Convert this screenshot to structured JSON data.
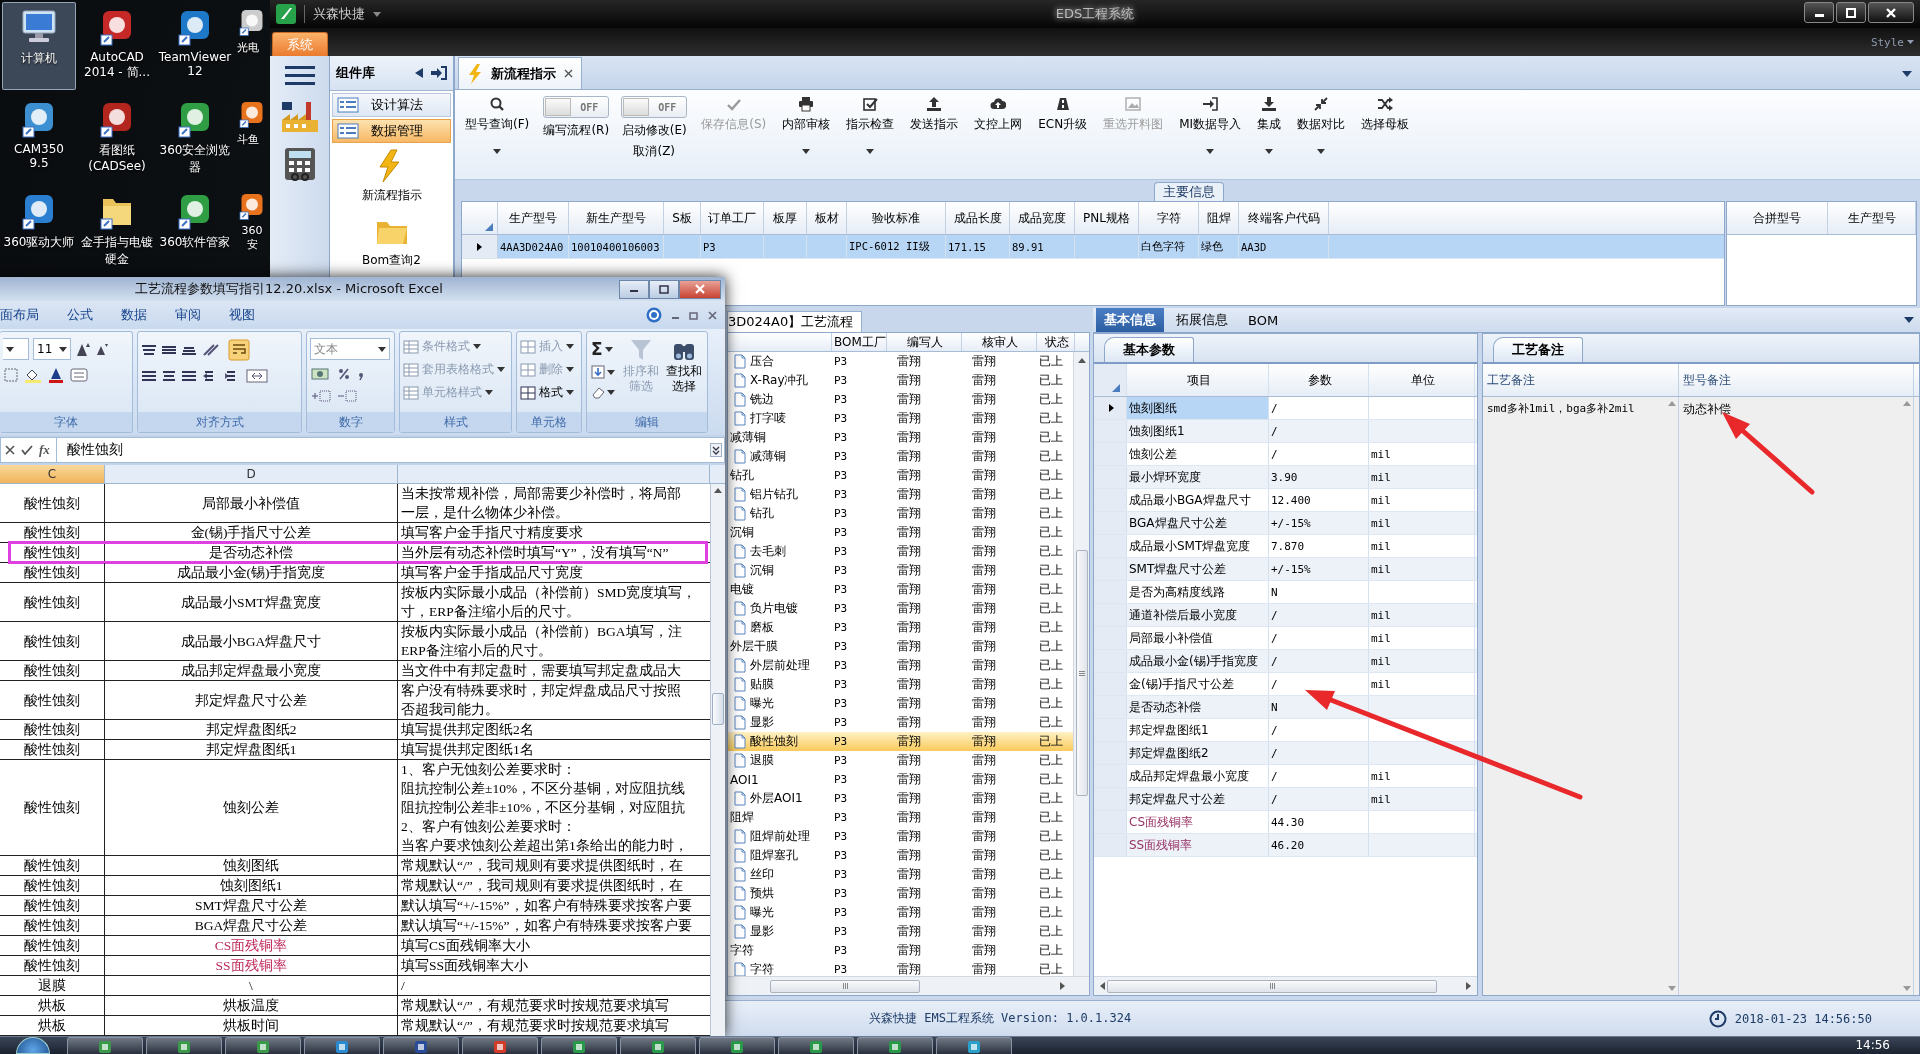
{
  "desktop": {
    "icons": [
      {
        "label": "计算机",
        "selected": true
      },
      {
        "label": "AutoCAD\n2014 - 简...",
        "selected": false
      },
      {
        "label": "TeamViewer\n12",
        "selected": false
      },
      {
        "label": "光电",
        "selected": false
      },
      {
        "label": "CAM350 9.5",
        "selected": false
      },
      {
        "label": "看图纸\n(CADSee)",
        "selected": false
      },
      {
        "label": "360安全浏览器",
        "selected": false
      },
      {
        "label": "斗鱼",
        "selected": false
      },
      {
        "label": "360驱动大师",
        "selected": false
      },
      {
        "label": "金手指与电镀硬金",
        "selected": false
      },
      {
        "label": "360软件管家",
        "selected": false
      },
      {
        "label": "360安",
        "selected": false
      }
    ]
  },
  "eds": {
    "app_name": "兴森快捷",
    "title": "EDS工程系统",
    "style_label": "Style",
    "system_tab": "系统",
    "library": {
      "title": "组件库",
      "categories": [
        {
          "label": "设计算法",
          "selected": false
        },
        {
          "label": "数据管理",
          "selected": true
        }
      ],
      "tools": [
        {
          "label": "新流程指示"
        },
        {
          "label": "Bom查询2"
        }
      ]
    },
    "doc_tab": "新流程指示",
    "toolbar": [
      {
        "kind": "button",
        "label": "型号查询(F)",
        "dropdown": true,
        "disabled": false
      },
      {
        "kind": "toggle",
        "label": "编写流程(R)",
        "switch_text": "OFF",
        "on": false
      },
      {
        "kind": "toggle",
        "label": "启动修改(E)",
        "sublabel": "取消(Z)",
        "switch_text": "OFF",
        "on": false
      },
      {
        "kind": "button",
        "label": "保存信息(S)",
        "dropdown": false,
        "disabled": true
      },
      {
        "kind": "button",
        "label": "内部审核",
        "dropdown": true,
        "disabled": false
      },
      {
        "kind": "button",
        "label": "指示检查",
        "dropdown": true,
        "disabled": false
      },
      {
        "kind": "button",
        "label": "发送指示",
        "dropdown": false,
        "disabled": false
      },
      {
        "kind": "button",
        "label": "文控上网",
        "dropdown": false,
        "disabled": false
      },
      {
        "kind": "button",
        "label": "ECN升级",
        "dropdown": false,
        "disabled": false
      },
      {
        "kind": "button",
        "label": "重选开料图",
        "dropdown": false,
        "disabled": true
      },
      {
        "kind": "button",
        "label": "MI数据导入",
        "dropdown": true,
        "disabled": false
      },
      {
        "kind": "button",
        "label": "集成",
        "dropdown": true,
        "disabled": false
      },
      {
        "kind": "button",
        "label": "数据对比",
        "dropdown": true,
        "disabled": false
      },
      {
        "kind": "button",
        "label": "选择母板",
        "dropdown": false,
        "disabled": false
      }
    ],
    "main_info": {
      "title": "主要信息",
      "columns": [
        "生产型号",
        "新生产型号",
        "S板",
        "订单工厂",
        "板厚",
        "板材",
        "验收标准",
        "成品长度",
        "成品宽度",
        "PNL规格",
        "字符",
        "阻焊",
        "终端客户代码"
      ],
      "rows": [
        {
          "selected": true,
          "cells": [
            "4AA3D024A0",
            "10010400106003",
            null,
            "P3",
            null,
            null,
            "IPC-6012 II级",
            "171.15",
            "89.91",
            null,
            "白色字符",
            "绿色",
            "AA3D"
          ]
        }
      ],
      "merge_columns": [
        "合拼型号",
        "生产型号"
      ]
    },
    "lower_tabs": [
      {
        "label": "基本信息",
        "selected": true
      },
      {
        "label": "拓展信息",
        "selected": false
      },
      {
        "label": "BOM",
        "selected": false
      }
    ],
    "flow": {
      "tab": "3D024A0】工艺流程",
      "columns": [
        "BOM工厂",
        "编写人",
        "核审人",
        "状态"
      ],
      "groups": [
        {
          "children": [
            {
              "name": "压合",
              "bom": "P3",
              "writer": "雷翔",
              "reviewer": "雷翔",
              "status": "已上",
              "selected": false
            },
            {
              "name": "X-Ray冲孔",
              "bom": "P3",
              "writer": "雷翔",
              "reviewer": "雷翔",
              "status": "已上",
              "selected": false
            },
            {
              "name": "铣边",
              "bom": "P3",
              "writer": "雷翔",
              "reviewer": "雷翔",
              "status": "已上",
              "selected": false
            },
            {
              "name": "打字唛",
              "bom": "P3",
              "writer": "雷翔",
              "reviewer": "雷翔",
              "status": "已上",
              "selected": false
            }
          ]
        },
        {
          "name": "减薄铜",
          "bom": "P3",
          "writer": "雷翔",
          "reviewer": "雷翔",
          "status": "已上",
          "selected": false,
          "children": [
            {
              "name": "减薄铜",
              "bom": "P3",
              "writer": "雷翔",
              "reviewer": "雷翔",
              "status": "已上",
              "selected": false
            }
          ]
        },
        {
          "name": "钻孔",
          "bom": "P3",
          "writer": "雷翔",
          "reviewer": "雷翔",
          "status": "已上",
          "selected": false,
          "children": [
            {
              "name": "铝片钻孔",
              "bom": "P3",
              "writer": "雷翔",
              "reviewer": "雷翔",
              "status": "已上",
              "selected": false
            },
            {
              "name": "钻孔",
              "bom": "P3",
              "writer": "雷翔",
              "reviewer": "雷翔",
              "status": "已上",
              "selected": false
            }
          ]
        },
        {
          "name": "沉铜",
          "bom": "P3",
          "writer": "雷翔",
          "reviewer": "雷翔",
          "status": "已上",
          "selected": false,
          "children": [
            {
              "name": "去毛刺",
              "bom": "P3",
              "writer": "雷翔",
              "reviewer": "雷翔",
              "status": "已上",
              "selected": false
            },
            {
              "name": "沉铜",
              "bom": "P3",
              "writer": "雷翔",
              "reviewer": "雷翔",
              "status": "已上",
              "selected": false
            }
          ]
        },
        {
          "name": "电镀",
          "bom": "P3",
          "writer": "雷翔",
          "reviewer": "雷翔",
          "status": "已上",
          "selected": false,
          "children": [
            {
              "name": "负片电镀",
              "bom": "P3",
              "writer": "雷翔",
              "reviewer": "雷翔",
              "status": "已上",
              "selected": false
            },
            {
              "name": "磨板",
              "bom": "P3",
              "writer": "雷翔",
              "reviewer": "雷翔",
              "status": "已上",
              "selected": false
            }
          ]
        },
        {
          "name": "外层干膜",
          "bom": "P3",
          "writer": "雷翔",
          "reviewer": "雷翔",
          "status": "已上",
          "selected": false,
          "children": [
            {
              "name": "外层前处理",
              "bom": "P3",
              "writer": "雷翔",
              "reviewer": "雷翔",
              "status": "已上",
              "selected": false
            },
            {
              "name": "贴膜",
              "bom": "P3",
              "writer": "雷翔",
              "reviewer": "雷翔",
              "status": "已上",
              "selected": false
            },
            {
              "name": "曝光",
              "bom": "P3",
              "writer": "雷翔",
              "reviewer": "雷翔",
              "status": "已上",
              "selected": false
            },
            {
              "name": "显影",
              "bom": "P3",
              "writer": "雷翔",
              "reviewer": "雷翔",
              "status": "已上",
              "selected": false
            },
            {
              "name": "酸性蚀刻",
              "bom": "P3",
              "writer": "雷翔",
              "reviewer": "雷翔",
              "status": "已上",
              "selected": true
            },
            {
              "name": "退膜",
              "bom": "P3",
              "writer": "雷翔",
              "reviewer": "雷翔",
              "status": "已上",
              "selected": false
            }
          ]
        },
        {
          "name": "AOI1",
          "bom": "P3",
          "writer": "雷翔",
          "reviewer": "雷翔",
          "status": "已上",
          "selected": false,
          "children": [
            {
              "name": "外层AOI1",
              "bom": "P3",
              "writer": "雷翔",
              "reviewer": "雷翔",
              "status": "已上",
              "selected": false
            }
          ]
        },
        {
          "name": "阻焊",
          "bom": "P3",
          "writer": "雷翔",
          "reviewer": "雷翔",
          "status": "已上",
          "selected": false,
          "children": [
            {
              "name": "阻焊前处理",
              "bom": "P3",
              "writer": "雷翔",
              "reviewer": "雷翔",
              "status": "已上",
              "selected": false
            },
            {
              "name": "阻焊塞孔",
              "bom": "P3",
              "writer": "雷翔",
              "reviewer": "雷翔",
              "status": "已上",
              "selected": false
            },
            {
              "name": "丝印",
              "bom": "P3",
              "writer": "雷翔",
              "reviewer": "雷翔",
              "status": "已上",
              "selected": false
            },
            {
              "name": "预烘",
              "bom": "P3",
              "writer": "雷翔",
              "reviewer": "雷翔",
              "status": "已上",
              "selected": false
            },
            {
              "name": "曝光",
              "bom": "P3",
              "writer": "雷翔",
              "reviewer": "雷翔",
              "status": "已上",
              "selected": false
            },
            {
              "name": "显影",
              "bom": "P3",
              "writer": "雷翔",
              "reviewer": "雷翔",
              "status": "已上",
              "selected": false
            }
          ]
        },
        {
          "name": "字符",
          "bom": "P3",
          "writer": "雷翔",
          "reviewer": "雷翔",
          "status": "已上",
          "selected": false,
          "children": [
            {
              "name": "字符",
              "bom": "P3",
              "writer": "雷翔",
              "reviewer": "雷翔",
              "status": "已上",
              "selected": false
            }
          ]
        }
      ]
    },
    "params": {
      "tab": "基本参数",
      "columns": [
        "项目",
        "参数",
        "单位"
      ],
      "rows": [
        {
          "name": "蚀刻图纸",
          "value": "/",
          "selected": true,
          "kind": "plain"
        },
        {
          "name": "蚀刻图纸1",
          "value": "/",
          "selected": false,
          "kind": "plain"
        },
        {
          "name": "蚀刻公差",
          "value": "/",
          "unit": "mil",
          "selected": false,
          "kind": "plain"
        },
        {
          "name": "最小焊环宽度",
          "value": "3.90",
          "unit": "mil",
          "selected": false,
          "kind": "plain"
        },
        {
          "name": "成品最小BGA焊盘尺寸",
          "value": "12.400",
          "unit": "mil",
          "selected": false,
          "kind": "plain"
        },
        {
          "name": "BGA焊盘尺寸公差",
          "value": "+/-15%",
          "unit": "mil",
          "selected": false,
          "kind": "plain"
        },
        {
          "name": "成品最小SMT焊盘宽度",
          "value": "7.870",
          "unit": "mil",
          "selected": false,
          "kind": "plain"
        },
        {
          "name": "SMT焊盘尺寸公差",
          "value": "+/-15%",
          "unit": "mil",
          "selected": false,
          "kind": "plain"
        },
        {
          "name": "是否为高精度线路",
          "value": "N",
          "selected": false,
          "kind": "plain"
        },
        {
          "name": "通道补偿后最小宽度",
          "value": "/",
          "unit": "mil",
          "selected": false,
          "kind": "plain"
        },
        {
          "name": "局部最小补偿值",
          "value": "/",
          "unit": "mil",
          "selected": false,
          "kind": "plain"
        },
        {
          "name": "成品最小金(锡)手指宽度",
          "value": "/",
          "unit": "mil",
          "selected": false,
          "kind": "plain"
        },
        {
          "name": "金(锡)手指尺寸公差",
          "value": "/",
          "unit": "mil",
          "selected": false,
          "kind": "plain"
        },
        {
          "name": "是否动态补偿",
          "value": "N",
          "selected": false,
          "kind": "plain"
        },
        {
          "name": "邦定焊盘图纸1",
          "value": "/",
          "selected": false,
          "kind": "plain"
        },
        {
          "name": "邦定焊盘图纸2",
          "value": "/",
          "selected": false,
          "kind": "plain"
        },
        {
          "name": "成品邦定焊盘最小宽度",
          "value": "/",
          "unit": "mil",
          "selected": false,
          "kind": "plain"
        },
        {
          "name": "邦定焊盘尺寸公差",
          "value": "/",
          "unit": "mil",
          "selected": false,
          "kind": "plain"
        },
        {
          "name": "CS面残铜率",
          "value": "44.30",
          "selected": false,
          "kind": "ratio"
        },
        {
          "name": "SS面残铜率",
          "value": "46.20",
          "selected": false,
          "kind": "ratio"
        }
      ]
    },
    "notes": {
      "tab": "工艺备注",
      "columns": [
        "工艺备注",
        "型号备注"
      ],
      "values": [
        "smd多补1mil，bga多补2mil",
        "动态补偿"
      ]
    },
    "status_bar": {
      "text": "兴森快捷 EMS工程系统 Version: 1.0.1.324",
      "datetime": "2018-01-23 14:56:50"
    }
  },
  "excel": {
    "title": "工艺流程参数填写指引12.20.xlsx - Microsoft Excel",
    "ribbon_tabs": [
      "面布局",
      "公式",
      "数据",
      "审阅",
      "视图"
    ],
    "font_size": "11",
    "number_format": "文本",
    "sum_symbol": "Σ",
    "groups": [
      "字体",
      "对齐方式",
      "数字",
      "样式",
      "单元格",
      "编辑"
    ],
    "style_commands": [
      "条件格式",
      "套用表格格式",
      "单元格样式"
    ],
    "cell_commands": [
      {
        "label": "插入",
        "disabled": true
      },
      {
        "label": "删除",
        "disabled": true
      },
      {
        "label": "格式",
        "disabled": false
      }
    ],
    "edit_commands": [
      {
        "label": "排序和筛选",
        "disabled": true
      },
      {
        "label": "查找和选择",
        "disabled": false
      }
    ],
    "function_symbol": "fx",
    "formula": "酸性蚀刻",
    "columns": [
      {
        "label": "C",
        "selected": true
      },
      {
        "label": "D",
        "selected": false
      }
    ],
    "rows": [
      {
        "c": "酸性蚀刻",
        "d": "局部最小补偿值",
        "e": [
          "当未按常规补偿，局部需要少补偿时，将局部",
          "一层，是什么物体少补偿。"
        ],
        "highlighted": false,
        "kind": "plain"
      },
      {
        "c": "酸性蚀刻",
        "d": "金(锡)手指尺寸公差",
        "e": [
          "填写客户金手指尺寸精度要求"
        ],
        "highlighted": false,
        "kind": "plain"
      },
      {
        "c": "酸性蚀刻",
        "d": "是否动态补偿",
        "e": [
          "当外层有动态补偿时填写“Y”，没有填写“N”"
        ],
        "highlighted": true,
        "kind": "plain"
      },
      {
        "c": "酸性蚀刻",
        "d": "成品最小金(锡)手指宽度",
        "e": [
          "填写客户金手指成品尺寸宽度"
        ],
        "highlighted": false,
        "kind": "plain"
      },
      {
        "c": "酸性蚀刻",
        "d": "成品最小SMT焊盘宽度",
        "e": [
          "按板内实际最小成品（补偿前）SMD宽度填写，",
          "寸，ERP备注缩小后的尺寸。"
        ],
        "highlighted": false,
        "kind": "plain"
      },
      {
        "c": "酸性蚀刻",
        "d": "成品最小BGA焊盘尺寸",
        "e": [
          "按板内实际最小成品（补偿前）BGA填写，注",
          "ERP备注缩小后的尺寸。"
        ],
        "highlighted": false,
        "kind": "plain"
      },
      {
        "c": "酸性蚀刻",
        "d": "成品邦定焊盘最小宽度",
        "e": [
          "当文件中有邦定盘时，需要填写邦定盘成品大"
        ],
        "highlighted": false,
        "kind": "plain"
      },
      {
        "c": "酸性蚀刻",
        "d": "邦定焊盘尺寸公差",
        "e": [
          "客户没有特殊要求时，邦定焊盘成品尺寸按照",
          "否超我司能力。"
        ],
        "highlighted": false,
        "kind": "plain"
      },
      {
        "c": "酸性蚀刻",
        "d": "邦定焊盘图纸2",
        "e": [
          "填写提供邦定图纸2名"
        ],
        "highlighted": false,
        "kind": "plain"
      },
      {
        "c": "酸性蚀刻",
        "d": "邦定焊盘图纸1",
        "e": [
          "填写提供邦定图纸1名"
        ],
        "highlighted": false,
        "kind": "plain"
      },
      {
        "c": "酸性蚀刻",
        "d": "蚀刻公差",
        "e": [
          "1、客户无蚀刻公差要求时：",
          "阻抗控制公差±10%，不区分基铜，对应阻抗线",
          "阻抗控制公差非±10%，不区分基铜，对应阻抗",
          "2、客户有蚀刻公差要求时：",
          "当客户要求蚀刻公差超出第1条给出的能力时，"
        ],
        "highlighted": false,
        "kind": "plain"
      },
      {
        "c": "酸性蚀刻",
        "d": "蚀刻图纸",
        "e": [
          "常规默认“/”，我司规则有要求提供图纸时，在"
        ],
        "highlighted": false,
        "kind": "plain"
      },
      {
        "c": "酸性蚀刻",
        "d": "蚀刻图纸1",
        "e": [
          "常规默认“/”，我司规则有要求提供图纸时，在"
        ],
        "highlighted": false,
        "kind": "plain"
      },
      {
        "c": "酸性蚀刻",
        "d": "SMT焊盘尺寸公差",
        "e": [
          "默认填写“+/-15%”，如客户有特殊要求按客户要"
        ],
        "highlighted": false,
        "kind": "plain"
      },
      {
        "c": "酸性蚀刻",
        "d": "BGA焊盘尺寸公差",
        "e": [
          "默认填写“+/-15%”，如客户有特殊要求按客户要"
        ],
        "highlighted": false,
        "kind": "plain"
      },
      {
        "c": "酸性蚀刻",
        "d": "CS面残铜率",
        "e": [
          "填写CS面残铜率大小"
        ],
        "highlighted": false,
        "kind": "ratio"
      },
      {
        "c": "酸性蚀刻",
        "d": "SS面残铜率",
        "e": [
          "填写SS面残铜率大小"
        ],
        "highlighted": false,
        "kind": "ratio"
      },
      {
        "c": "退膜",
        "d": "\\",
        "e": [
          "/"
        ],
        "highlighted": false,
        "kind": "plain"
      },
      {
        "c": "烘板",
        "d": "烘板温度",
        "e": [
          "常规默认“/”，有规范要求时按规范要求填写"
        ],
        "highlighted": false,
        "kind": "plain"
      },
      {
        "c": "烘板",
        "d": "烘板时间",
        "e": [
          "常规默认“/”，有规范要求时按规范要求填写"
        ],
        "highlighted": false,
        "kind": "plain"
      }
    ]
  },
  "taskbar": {
    "clock": "14:56"
  }
}
